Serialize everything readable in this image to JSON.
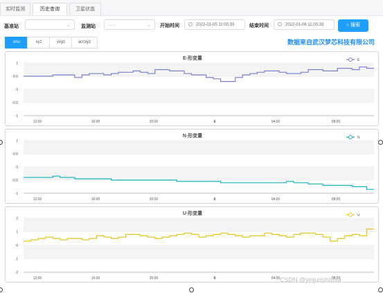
{
  "tabs": [
    "实时监测",
    "历史查询",
    "卫星状态"
  ],
  "filters": {
    "base_label": "基准站",
    "base_value": "",
    "monitor_label": "监测站",
    "monitor_value": "......",
    "start_label": "开始时间",
    "start_value": "2022-01-05 11:00:33",
    "end_label": "结束时间",
    "end_value": "2022-01-06 11:00:33",
    "search_label": "搜索"
  },
  "sub_tabs": [
    "enu",
    "xyz",
    "vxyz",
    "accxyz"
  ],
  "source_text": "数据来自武汉梦芯科技有限公司",
  "watermark": "CSDN @yinjunshishui",
  "charts": [
    {
      "title": "E-形变量",
      "legend": "E",
      "color": "#7b7fd6",
      "yticks": [
        "1",
        "0.5",
        "0",
        "-0.5",
        "-1"
      ],
      "xticks": [
        "12:00",
        "16:00",
        "20:00",
        "6",
        "04:00",
        "08:00"
      ]
    },
    {
      "title": "N-形变量",
      "legend": "N",
      "color": "#11b3c6",
      "yticks": [
        "1",
        "0.5",
        "0",
        "-0.5",
        "-1"
      ],
      "xticks": [
        "12:00",
        "16:00",
        "20:00",
        "6",
        "04:00",
        "08:00"
      ]
    },
    {
      "title": "U-形变量",
      "legend": "U",
      "color": "#e8c51a",
      "yticks": [
        "2",
        "1",
        "0",
        "-1",
        "-2"
      ],
      "xticks": [
        "12:00",
        "16:00",
        "20:00",
        "6",
        "04:00",
        "08:00"
      ]
    }
  ],
  "chart_data": [
    {
      "type": "line",
      "title": "E-形变量",
      "series": [
        {
          "name": "E",
          "values": [
            0.5,
            0.5,
            0.5,
            0.5,
            0.55,
            0.55,
            0.55,
            0.45,
            0.55,
            0.6,
            0.6,
            0.55,
            0.6,
            0.65,
            0.65,
            0.7,
            0.65,
            0.6,
            0.75,
            0.75,
            0.7,
            0.7,
            0.6,
            0.55,
            0.55,
            0.45,
            0.4,
            0.3,
            0.3,
            0.45,
            0.55,
            0.6,
            0.65,
            0.7,
            0.7,
            0.65,
            0.6,
            0.6,
            0.65,
            0.75,
            0.75,
            0.7,
            0.7,
            0.8,
            0.8,
            0.75,
            0.85,
            0.8,
            0.8
          ]
        }
      ],
      "ylim": [
        -1,
        1
      ]
    },
    {
      "type": "line",
      "title": "N-形变量",
      "series": [
        {
          "name": "N",
          "values": [
            -0.4,
            -0.4,
            -0.4,
            -0.4,
            -0.35,
            -0.4,
            -0.4,
            -0.45,
            -0.45,
            -0.45,
            -0.45,
            -0.45,
            -0.5,
            -0.5,
            -0.5,
            -0.5,
            -0.5,
            -0.5,
            -0.5,
            -0.5,
            -0.5,
            -0.55,
            -0.55,
            -0.55,
            -0.55,
            -0.55,
            -0.55,
            -0.6,
            -0.6,
            -0.6,
            -0.6,
            -0.6,
            -0.6,
            -0.6,
            -0.6,
            -0.6,
            -0.55,
            -0.6,
            -0.6,
            -0.65,
            -0.65,
            -0.7,
            -0.7,
            -0.7,
            -0.7,
            -0.75,
            -0.75,
            -0.85,
            -0.85
          ]
        }
      ],
      "ylim": [
        -1,
        1
      ]
    },
    {
      "type": "line",
      "title": "U-形变量",
      "series": [
        {
          "name": "U",
          "values": [
            0.3,
            0.4,
            0.5,
            0.6,
            0.5,
            0.4,
            0.5,
            0.5,
            0.4,
            0.5,
            0.7,
            0.6,
            0.5,
            0.6,
            0.8,
            0.8,
            0.7,
            0.6,
            0.5,
            0.6,
            0.7,
            0.8,
            0.9,
            0.8,
            0.6,
            0.7,
            0.8,
            0.9,
            0.8,
            0.7,
            0.6,
            0.7,
            0.7,
            0.9,
            0.8,
            0.7,
            0.6,
            0.8,
            0.9,
            0.9,
            0.8,
            0.6,
            0.3,
            0.5,
            0.7,
            0.8,
            0.7,
            1.2,
            1.2
          ]
        }
      ],
      "ylim": [
        -2,
        2
      ]
    }
  ]
}
